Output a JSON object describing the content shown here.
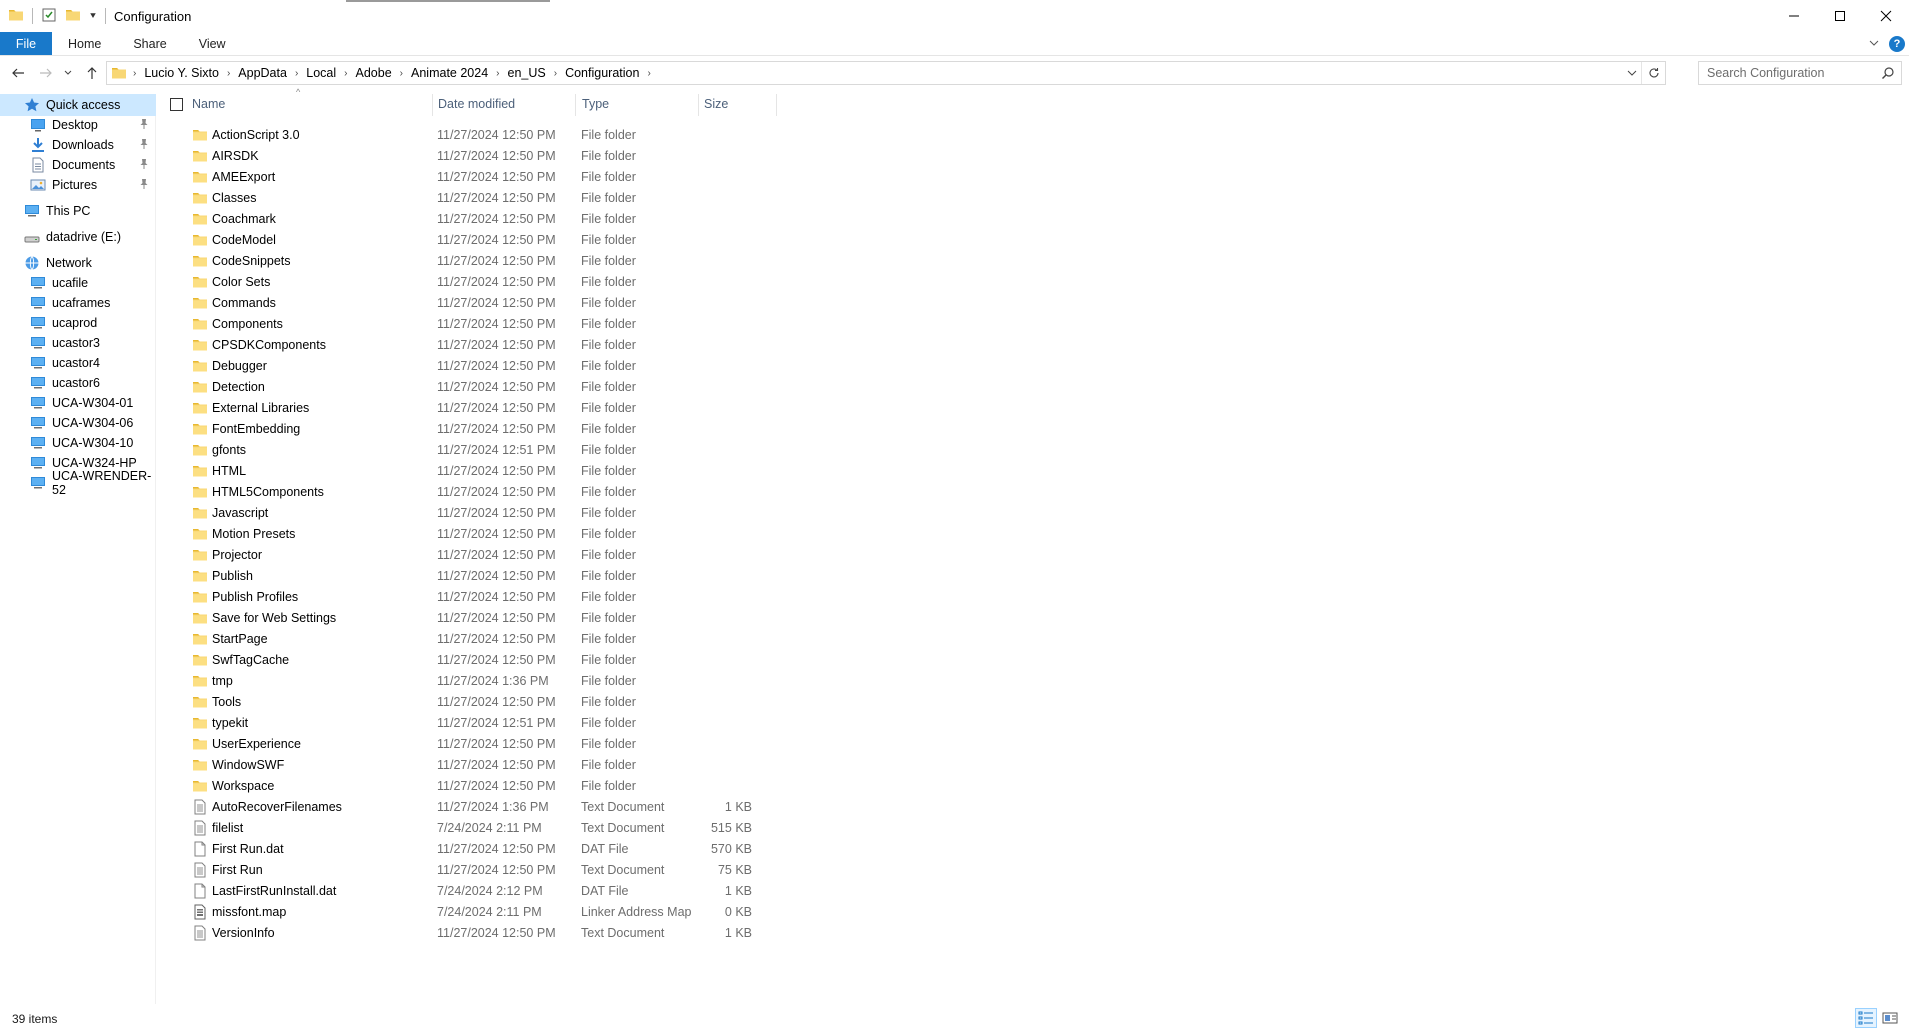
{
  "window": {
    "title": "Configuration"
  },
  "ribbon": {
    "tabs": [
      "File",
      "Home",
      "Share",
      "View"
    ]
  },
  "address": {
    "crumbs": [
      "Lucio Y. Sixto",
      "AppData",
      "Local",
      "Adobe",
      "Animate 2024",
      "en_US",
      "Configuration"
    ]
  },
  "search": {
    "placeholder": "Search Configuration"
  },
  "sidebar": {
    "items": [
      {
        "label": "Quick access",
        "icon": "star-icon",
        "indent": 0,
        "pinned": false,
        "selected": true
      },
      {
        "label": "Desktop",
        "icon": "desktop-icon",
        "indent": 1,
        "pinned": true,
        "selected": false
      },
      {
        "label": "Downloads",
        "icon": "download-icon",
        "indent": 1,
        "pinned": true,
        "selected": false
      },
      {
        "label": "Documents",
        "icon": "documents-icon",
        "indent": 1,
        "pinned": true,
        "selected": false
      },
      {
        "label": "Pictures",
        "icon": "pictures-icon",
        "indent": 1,
        "pinned": true,
        "selected": false
      },
      {
        "label": "This PC",
        "icon": "computer-icon",
        "indent": 0,
        "pinned": false,
        "selected": false
      },
      {
        "label": "datadrive (E:)",
        "icon": "drive-icon",
        "indent": 0,
        "pinned": false,
        "selected": false
      },
      {
        "label": "Network",
        "icon": "network-icon",
        "indent": 0,
        "pinned": false,
        "selected": false
      },
      {
        "label": "ucafile",
        "icon": "computer-icon",
        "indent": 1,
        "pinned": false,
        "selected": false
      },
      {
        "label": "ucaframes",
        "icon": "computer-icon",
        "indent": 1,
        "pinned": false,
        "selected": false
      },
      {
        "label": "ucaprod",
        "icon": "computer-icon",
        "indent": 1,
        "pinned": false,
        "selected": false
      },
      {
        "label": "ucastor3",
        "icon": "computer-icon",
        "indent": 1,
        "pinned": false,
        "selected": false
      },
      {
        "label": "ucastor4",
        "icon": "computer-icon",
        "indent": 1,
        "pinned": false,
        "selected": false
      },
      {
        "label": "ucastor6",
        "icon": "computer-icon",
        "indent": 1,
        "pinned": false,
        "selected": false
      },
      {
        "label": "UCA-W304-01",
        "icon": "computer-icon",
        "indent": 1,
        "pinned": false,
        "selected": false
      },
      {
        "label": "UCA-W304-06",
        "icon": "computer-icon",
        "indent": 1,
        "pinned": false,
        "selected": false
      },
      {
        "label": "UCA-W304-10",
        "icon": "computer-icon",
        "indent": 1,
        "pinned": false,
        "selected": false
      },
      {
        "label": "UCA-W324-HP",
        "icon": "computer-icon",
        "indent": 1,
        "pinned": false,
        "selected": false
      },
      {
        "label": "UCA-WRENDER-52",
        "icon": "computer-icon",
        "indent": 1,
        "pinned": false,
        "selected": false
      }
    ]
  },
  "columns": [
    "Name",
    "Date modified",
    "Type",
    "Size"
  ],
  "files": [
    {
      "name": "ActionScript 3.0",
      "date": "11/27/2024 12:50 PM",
      "type": "File folder",
      "size": "",
      "kind": "folder"
    },
    {
      "name": "AIRSDK",
      "date": "11/27/2024 12:50 PM",
      "type": "File folder",
      "size": "",
      "kind": "folder"
    },
    {
      "name": "AMEExport",
      "date": "11/27/2024 12:50 PM",
      "type": "File folder",
      "size": "",
      "kind": "folder"
    },
    {
      "name": "Classes",
      "date": "11/27/2024 12:50 PM",
      "type": "File folder",
      "size": "",
      "kind": "folder"
    },
    {
      "name": "Coachmark",
      "date": "11/27/2024 12:50 PM",
      "type": "File folder",
      "size": "",
      "kind": "folder"
    },
    {
      "name": "CodeModel",
      "date": "11/27/2024 12:50 PM",
      "type": "File folder",
      "size": "",
      "kind": "folder"
    },
    {
      "name": "CodeSnippets",
      "date": "11/27/2024 12:50 PM",
      "type": "File folder",
      "size": "",
      "kind": "folder"
    },
    {
      "name": "Color Sets",
      "date": "11/27/2024 12:50 PM",
      "type": "File folder",
      "size": "",
      "kind": "folder"
    },
    {
      "name": "Commands",
      "date": "11/27/2024 12:50 PM",
      "type": "File folder",
      "size": "",
      "kind": "folder"
    },
    {
      "name": "Components",
      "date": "11/27/2024 12:50 PM",
      "type": "File folder",
      "size": "",
      "kind": "folder"
    },
    {
      "name": "CPSDKComponents",
      "date": "11/27/2024 12:50 PM",
      "type": "File folder",
      "size": "",
      "kind": "folder"
    },
    {
      "name": "Debugger",
      "date": "11/27/2024 12:50 PM",
      "type": "File folder",
      "size": "",
      "kind": "folder"
    },
    {
      "name": "Detection",
      "date": "11/27/2024 12:50 PM",
      "type": "File folder",
      "size": "",
      "kind": "folder"
    },
    {
      "name": "External Libraries",
      "date": "11/27/2024 12:50 PM",
      "type": "File folder",
      "size": "",
      "kind": "folder"
    },
    {
      "name": "FontEmbedding",
      "date": "11/27/2024 12:50 PM",
      "type": "File folder",
      "size": "",
      "kind": "folder"
    },
    {
      "name": "gfonts",
      "date": "11/27/2024 12:51 PM",
      "type": "File folder",
      "size": "",
      "kind": "folder"
    },
    {
      "name": "HTML",
      "date": "11/27/2024 12:50 PM",
      "type": "File folder",
      "size": "",
      "kind": "folder"
    },
    {
      "name": "HTML5Components",
      "date": "11/27/2024 12:50 PM",
      "type": "File folder",
      "size": "",
      "kind": "folder"
    },
    {
      "name": "Javascript",
      "date": "11/27/2024 12:50 PM",
      "type": "File folder",
      "size": "",
      "kind": "folder"
    },
    {
      "name": "Motion Presets",
      "date": "11/27/2024 12:50 PM",
      "type": "File folder",
      "size": "",
      "kind": "folder"
    },
    {
      "name": "Projector",
      "date": "11/27/2024 12:50 PM",
      "type": "File folder",
      "size": "",
      "kind": "folder"
    },
    {
      "name": "Publish",
      "date": "11/27/2024 12:50 PM",
      "type": "File folder",
      "size": "",
      "kind": "folder"
    },
    {
      "name": "Publish Profiles",
      "date": "11/27/2024 12:50 PM",
      "type": "File folder",
      "size": "",
      "kind": "folder"
    },
    {
      "name": "Save for Web Settings",
      "date": "11/27/2024 12:50 PM",
      "type": "File folder",
      "size": "",
      "kind": "folder"
    },
    {
      "name": "StartPage",
      "date": "11/27/2024 12:50 PM",
      "type": "File folder",
      "size": "",
      "kind": "folder"
    },
    {
      "name": "SwfTagCache",
      "date": "11/27/2024 12:50 PM",
      "type": "File folder",
      "size": "",
      "kind": "folder"
    },
    {
      "name": "tmp",
      "date": "11/27/2024 1:36 PM",
      "type": "File folder",
      "size": "",
      "kind": "folder"
    },
    {
      "name": "Tools",
      "date": "11/27/2024 12:50 PM",
      "type": "File folder",
      "size": "",
      "kind": "folder"
    },
    {
      "name": "typekit",
      "date": "11/27/2024 12:51 PM",
      "type": "File folder",
      "size": "",
      "kind": "folder"
    },
    {
      "name": "UserExperience",
      "date": "11/27/2024 12:50 PM",
      "type": "File folder",
      "size": "",
      "kind": "folder"
    },
    {
      "name": "WindowSWF",
      "date": "11/27/2024 12:50 PM",
      "type": "File folder",
      "size": "",
      "kind": "folder"
    },
    {
      "name": "Workspace",
      "date": "11/27/2024 12:50 PM",
      "type": "File folder",
      "size": "",
      "kind": "folder"
    },
    {
      "name": "AutoRecoverFilenames",
      "date": "11/27/2024 1:36 PM",
      "type": "Text Document",
      "size": "1 KB",
      "kind": "text"
    },
    {
      "name": "filelist",
      "date": "7/24/2024 2:11 PM",
      "type": "Text Document",
      "size": "515 KB",
      "kind": "text"
    },
    {
      "name": "First Run.dat",
      "date": "11/27/2024 12:50 PM",
      "type": "DAT File",
      "size": "570 KB",
      "kind": "blank"
    },
    {
      "name": "First Run",
      "date": "11/27/2024 12:50 PM",
      "type": "Text Document",
      "size": "75 KB",
      "kind": "text"
    },
    {
      "name": "LastFirstRunInstall.dat",
      "date": "7/24/2024 2:12 PM",
      "type": "DAT File",
      "size": "1 KB",
      "kind": "blank"
    },
    {
      "name": "missfont.map",
      "date": "7/24/2024 2:11 PM",
      "type": "Linker Address Map",
      "size": "0 KB",
      "kind": "map"
    },
    {
      "name": "VersionInfo",
      "date": "11/27/2024 12:50 PM",
      "type": "Text Document",
      "size": "1 KB",
      "kind": "text"
    }
  ],
  "status": {
    "count": "39 items"
  },
  "colors": {
    "accent": "#1979ca",
    "selection": "#cce8ff",
    "folder": "#f8d775",
    "folder_tab": "#e8b830"
  }
}
